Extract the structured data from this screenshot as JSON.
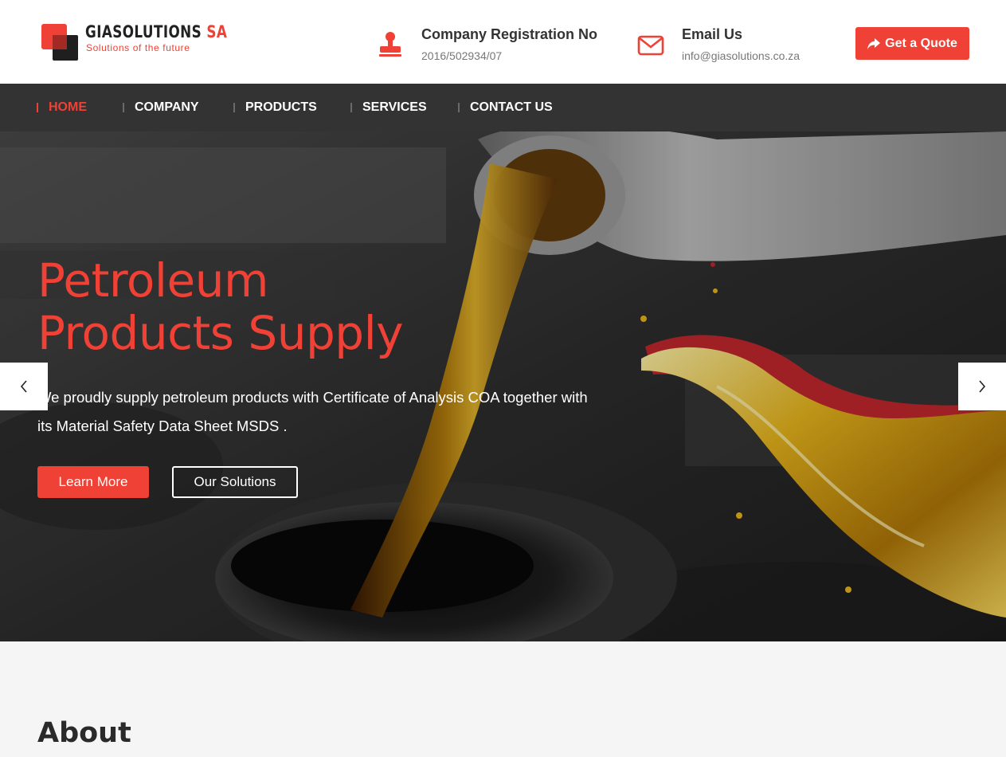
{
  "brand": {
    "name_main": "GIASOLUTIONS",
    "name_accent": "SA",
    "tagline": "Solutions of the future"
  },
  "header": {
    "registration": {
      "title": "Company Registration No",
      "value": "2016/502934/07",
      "icon": "stamp-icon"
    },
    "email": {
      "title": "Email Us",
      "value": "info@giasolutions.co.za",
      "icon": "envelope-icon"
    },
    "quote_button": "Get a Quote"
  },
  "nav": {
    "items": [
      {
        "label": "HOME",
        "active": true
      },
      {
        "label": "COMPANY",
        "active": false
      },
      {
        "label": "PRODUCTS",
        "active": false
      },
      {
        "label": "SERVICES",
        "active": false
      },
      {
        "label": "CONTACT US",
        "active": false
      }
    ]
  },
  "hero": {
    "title_line1": "Petroleum",
    "title_line2": "Products Supply",
    "description": "We proudly supply petroleum products with Certificate of Analysis COA together with its Material Safety Data Sheet MSDS .",
    "learn_more": "Learn More",
    "our_solutions": "Our Solutions"
  },
  "about": {
    "title": "About"
  },
  "colors": {
    "accent": "#ef4135",
    "nav_bg": "#333333",
    "page_bg": "#f5f5f5"
  }
}
